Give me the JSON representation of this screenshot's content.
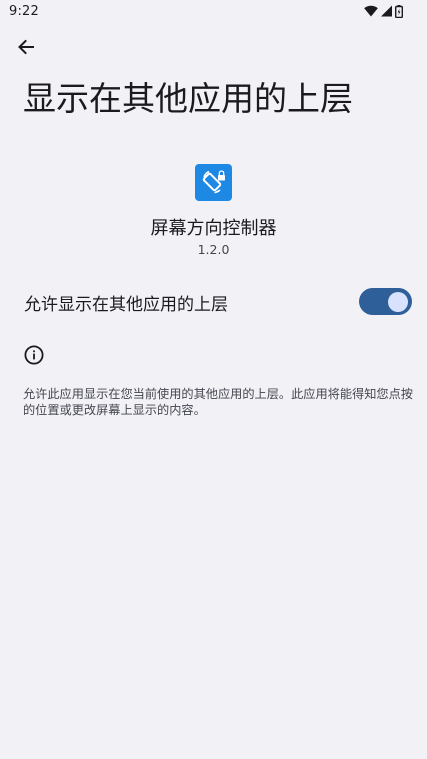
{
  "status_bar": {
    "time": "9:22",
    "icons": [
      "wifi-icon",
      "signal-icon",
      "battery-icon"
    ]
  },
  "toolbar": {
    "back_icon": "arrow-left-icon",
    "title": "显示在其他应用的上层"
  },
  "app": {
    "icon": "screen-rotation-lock-icon",
    "icon_color": "#1e88e5",
    "name": "屏幕方向控制器",
    "version": "1.2.0"
  },
  "permission_toggle": {
    "label": "允许显示在其他应用的上层",
    "state": "on",
    "accent_color": "#2f5f99"
  },
  "info": {
    "icon": "info-icon",
    "text": "允许此应用显示在您当前使用的其他应用的上层。此应用将能得知您点按的位置或更改屏幕上显示的内容。"
  }
}
